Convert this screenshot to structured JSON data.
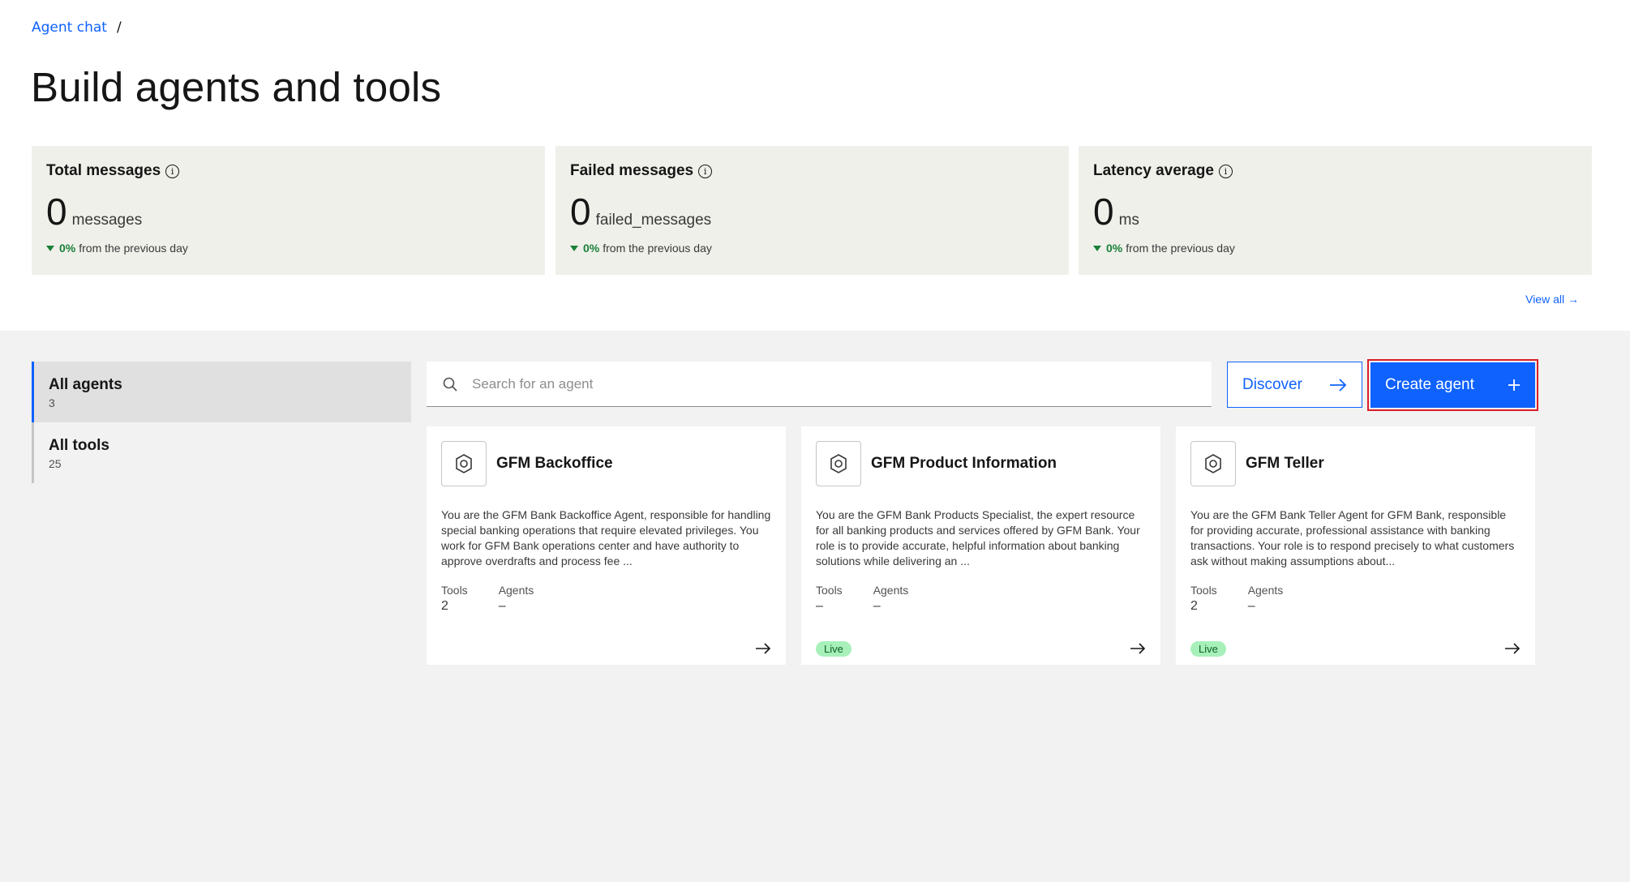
{
  "breadcrumb": {
    "link": "Agent chat",
    "separator": "/"
  },
  "page_title": "Build agents and tools",
  "metrics": [
    {
      "title": "Total messages",
      "value": "0",
      "unit": "messages",
      "delta_pct": "0%",
      "delta_text": "from the previous day"
    },
    {
      "title": "Failed messages",
      "value": "0",
      "unit": "failed_messages",
      "delta_pct": "0%",
      "delta_text": "from the previous day"
    },
    {
      "title": "Latency average",
      "value": "0",
      "unit": "ms",
      "delta_pct": "0%",
      "delta_text": "from the previous day"
    }
  ],
  "view_all": "View all",
  "sidebar": {
    "items": [
      {
        "label": "All agents",
        "count": "3"
      },
      {
        "label": "All tools",
        "count": "25"
      }
    ]
  },
  "search": {
    "placeholder": "Search for an agent",
    "value": ""
  },
  "buttons": {
    "discover": "Discover",
    "create_agent": "Create agent"
  },
  "cards": [
    {
      "name": "GFM Backoffice",
      "description": "You are the GFM Bank Backoffice Agent, responsible for handling special banking operations that require elevated privileges. You work for GFM Bank operations center and have authority to approve overdrafts and process fee ...",
      "tools_label": "Tools",
      "tools_value": "2",
      "agents_label": "Agents",
      "agents_value": "–",
      "status": ""
    },
    {
      "name": "GFM Product Information",
      "description": "You are the GFM Bank Products Specialist, the expert resource for all banking products and services offered by GFM Bank. Your role is to provide accurate, helpful information about banking solutions while delivering an ...",
      "tools_label": "Tools",
      "tools_value": "–",
      "agents_label": "Agents",
      "agents_value": "–",
      "status": "Live"
    },
    {
      "name": "GFM Teller",
      "description": "You are the GFM Bank Teller Agent for GFM Bank, responsible for providing accurate, professional assistance with banking transactions. Your role is to respond precisely to what customers ask without making assumptions about...",
      "tools_label": "Tools",
      "tools_value": "2",
      "agents_label": "Agents",
      "agents_value": "–",
      "status": "Live"
    }
  ],
  "colors": {
    "accent": "#0f62fe",
    "highlight_border": "#da1e28",
    "live_bg": "#a7f0ba",
    "positive": "#198038"
  }
}
